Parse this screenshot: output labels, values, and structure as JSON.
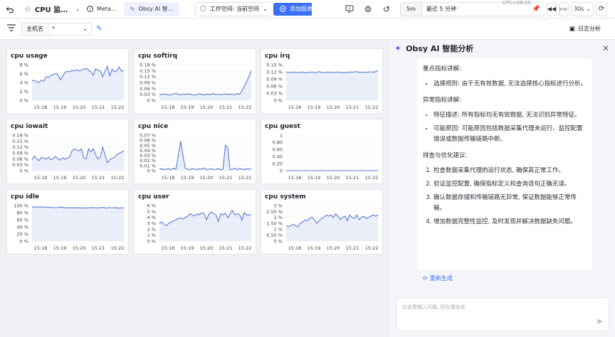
{
  "topbar": {
    "dashboard_title": "CPU 监…",
    "tabs": [
      {
        "label": "Meta…"
      },
      {
        "label": "Obsy AI 智…"
      }
    ],
    "workspace_label": "工作空间: 当前空间",
    "add_chart_label": "添加图表",
    "interval": "5m",
    "time_range": "最近 5 分钟",
    "refresh_interval": "30s",
    "timezone": "UTC+08:00"
  },
  "filter": {
    "label": "主机名",
    "value": "*",
    "log_analysis_label": "日志分析"
  },
  "panels": [
    {
      "title": "cpu usage",
      "yticks": [
        "8 %",
        "6 %",
        "4 %",
        "2 %",
        "0 %"
      ],
      "ymax": 8,
      "values": [
        4.4,
        4.5,
        4.2,
        4.0,
        4.5,
        4.3,
        5.3,
        5.1,
        5.6,
        5.8,
        6.0,
        5.8,
        4.6,
        5.4,
        6.3,
        6.5,
        6.4,
        6.7,
        6.6,
        6.9,
        6.6,
        6.8,
        7.0,
        7.2,
        6.8,
        6.4,
        5.6,
        7.1,
        6.7,
        6.6,
        5.3,
        6.5,
        7.6,
        5.5,
        7.0,
        6.4,
        6.6,
        7.5,
        6.5,
        6.8
      ]
    },
    {
      "title": "cpu softirq",
      "yticks": [
        "0.18 %",
        "0.15 %",
        "0.12 %",
        "0.09 %",
        "0.06 %",
        "0.03 %",
        "0 %"
      ],
      "ymax": 0.18,
      "values": [
        0.03,
        0.028,
        0.032,
        0.03,
        0.026,
        0.029,
        0.031,
        0.036,
        0.03,
        0.027,
        0.031,
        0.029,
        0.033,
        0.03,
        0.028,
        0.025,
        0.03,
        0.033,
        0.029,
        0.026,
        0.032,
        0.029,
        0.03,
        0.034,
        0.028,
        0.031,
        0.027,
        0.03,
        0.032,
        0.029,
        0.031,
        0.03,
        0.028,
        0.034,
        0.03,
        0.045,
        0.07,
        0.095,
        0.12,
        0.15
      ]
    },
    {
      "title": "cpu irq",
      "yticks": [
        "0.15 %",
        "0.12 %",
        "0.09 %",
        "0.06 %",
        "0.03 %",
        "0 %"
      ],
      "ymax": 0.15,
      "values": [
        0.119,
        0.118,
        0.117,
        0.119,
        0.118,
        0.117,
        0.118,
        0.119,
        0.116,
        0.117,
        0.118,
        0.119,
        0.118,
        0.117,
        0.121,
        0.118,
        0.117,
        0.118,
        0.119,
        0.117,
        0.118,
        0.117,
        0.119,
        0.118,
        0.116,
        0.118,
        0.117,
        0.119,
        0.118,
        0.12,
        0.121,
        0.117,
        0.118,
        0.119,
        0.117,
        0.119,
        0.12,
        0.118,
        0.121,
        0.125
      ]
    },
    {
      "title": "cpu iowait",
      "yticks": [
        "0.18 %",
        "0.15 %",
        "0.12 %",
        "0.09 %",
        "0.06 %",
        "0.03 %",
        "0 %"
      ],
      "ymax": 0.18,
      "values": [
        0.055,
        0.074,
        0.06,
        0.05,
        0.068,
        0.062,
        0.058,
        0.07,
        0.055,
        0.062,
        0.072,
        0.06,
        0.054,
        0.065,
        0.058,
        0.064,
        0.07,
        0.1,
        0.11,
        0.105,
        0.1,
        0.11,
        0.065,
        0.06,
        0.11,
        0.095,
        0.11,
        0.08,
        0.06,
        0.068,
        0.12,
        0.08,
        0.04,
        0.055,
        0.062,
        0.068,
        0.08,
        0.088,
        0.094,
        0.102
      ]
    },
    {
      "title": "cpu nice",
      "yticks": [
        "0.07 %",
        "0.06 %",
        "0.05 %",
        "0.04 %",
        "0.03 %",
        "0.02 %",
        "0.01 %",
        "0 %"
      ],
      "ymax": 0.07,
      "values": [
        0.003,
        0.004,
        0.002,
        0.003,
        0.004,
        0.002,
        0.005,
        0.003,
        0.03,
        0.058,
        0.03,
        0.004,
        0.003,
        0.002,
        0.004,
        0.003,
        0.002,
        0.004,
        0.003,
        0.005,
        0.002,
        0.003,
        0.004,
        0.002,
        0.003,
        0.004,
        0.002,
        0.003,
        0.05,
        0.045,
        0.002,
        0.003,
        0.005,
        0.002,
        0.004,
        0.003,
        0.002,
        0.004,
        0.003,
        0.004
      ]
    },
    {
      "title": "cpu guest",
      "yticks": [
        "1",
        "0.80",
        "0.60",
        "0.40",
        "0.20",
        "0"
      ],
      "ymax": 1,
      "values": [
        0,
        0,
        0,
        0,
        0,
        0,
        0,
        0,
        0,
        0,
        0,
        0,
        0,
        0,
        0,
        0,
        0,
        0,
        0,
        0,
        0,
        0,
        0,
        0,
        0,
        0,
        0,
        0,
        0,
        0,
        0,
        0,
        0,
        0,
        0,
        0,
        0,
        0,
        0,
        0
      ]
    },
    {
      "title": "cpu idle",
      "yticks": [
        "100 %",
        "80 %",
        "60 %",
        "40 %",
        "20 %",
        "0 %"
      ],
      "ymax": 100,
      "values": [
        95.6,
        95.5,
        95.8,
        96.0,
        95.5,
        95.7,
        94.7,
        94.9,
        94.4,
        94.2,
        94.0,
        94.2,
        95.4,
        94.6,
        93.7,
        93.5,
        93.6,
        93.3,
        93.4,
        93.1,
        93.4,
        93.2,
        93.0,
        92.8,
        93.2,
        93.6,
        94.4,
        92.9,
        93.3,
        93.4,
        94.7,
        93.5,
        92.4,
        94.5,
        93.0,
        93.6,
        93.4,
        92.5,
        93.5,
        93.2
      ]
    },
    {
      "title": "cpu user",
      "yticks": [
        "6 %",
        "5 %",
        "4 %",
        "3 %",
        "2 %",
        "1 %",
        "0 %"
      ],
      "ymax": 6,
      "values": [
        3.0,
        3.2,
        2.8,
        2.6,
        3.0,
        3.2,
        3.4,
        3.6,
        3.8,
        3.9,
        3.7,
        4.0,
        4.2,
        4.6,
        4.4,
        4.2,
        4.6,
        4.4,
        4.8,
        4.6,
        3.6,
        4.5,
        4.9,
        4.6,
        4.4,
        3.3,
        4.6,
        4.4,
        4.7,
        3.9,
        4.6,
        5.2,
        4.4,
        4.6,
        4.5,
        3.5,
        4.8,
        4.4,
        4.4,
        4.5
      ]
    },
    {
      "title": "cpu system",
      "yticks": [
        "3 %",
        "2.50 %",
        "2 %",
        "1.50 %",
        "1 %",
        "0.50 %",
        "0 %"
      ],
      "ymax": 3,
      "values": [
        1.3,
        1.2,
        1.3,
        1.4,
        1.3,
        1.2,
        1.5,
        1.6,
        1.8,
        1.7,
        1.9,
        2.0,
        1.8,
        1.5,
        1.7,
        1.9,
        2.0,
        2.2,
        2.1,
        2.2,
        2.0,
        2.3,
        2.1,
        1.8,
        2.0,
        2.1,
        1.7,
        2.2,
        2.0,
        1.9,
        2.2,
        1.8,
        2.0,
        2.1,
        1.9,
        2.0,
        2.1,
        2.2,
        2.1,
        2.2
      ]
    }
  ],
  "xticks": [
    "15:18",
    "15:19",
    "15:20",
    "15:21",
    "15:22"
  ],
  "line_color": "#5b7bd5",
  "ai": {
    "title": "Obsy AI 智能分析",
    "section1": "重点指标讲解:",
    "section1_items": [
      "选择规则: 由于无有效数据, 无法选择核心指标进行分析。"
    ],
    "section2": "异常指标讲解:",
    "section2_items": [
      "特征描述: 所有指标均无有效数据, 无法识别异常特征。",
      "可能原因: 可能原因包括数据采集代理未运行、监控配置错误或数据传输链路中断。"
    ],
    "section3": "排查与优化建议:",
    "section3_items": [
      "检查数据采集代理的运行状态, 确保其正常工作。",
      "验证监控配置, 确保指标定义和查询语句正确无误。",
      "确认数据存储和传输链路无异常, 保证数据能够正常传输。",
      "增加数据完整性监控, 及时发现并解决数据缺失问题。"
    ],
    "regenerate_label": "重新生成",
    "input_placeholder": "在这里输入问题, 回车键发送"
  }
}
